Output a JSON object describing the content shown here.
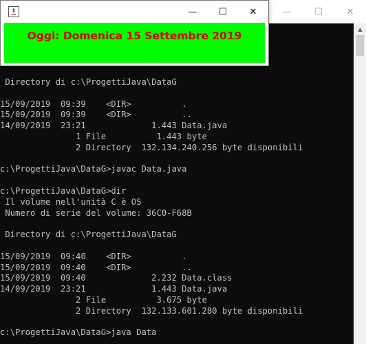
{
  "java_window": {
    "date_text": "Oggi: Domenica 15 Settembre 2019",
    "background_color": "#00ff00",
    "text_color": "#d40000"
  },
  "console": {
    "lines": [
      " Directory di c:\\ProgettiJava\\DataG",
      "",
      "15/09/2019  09:39    <DIR>          .",
      "15/09/2019  09:39    <DIR>          ..",
      "14/09/2019  23:21             1.443 Data.java",
      "               1 File          1.443 byte",
      "               2 Directory  132.134.240.256 byte disponibili",
      "",
      "c:\\ProgettiJava\\DataG>javac Data.java",
      "",
      "c:\\ProgettiJava\\DataG>dir",
      " Il volume nell'unità C è OS",
      " Numero di serie del volume: 36C0-F68B",
      "",
      " Directory di c:\\ProgettiJava\\DataG",
      "",
      "15/09/2019  09:40    <DIR>          .",
      "15/09/2019  09:40    <DIR>          ..",
      "15/09/2019  09:40             2.232 Data.class",
      "14/09/2019  23:21             1.443 Data.java",
      "               2 File          3.675 byte",
      "               2 Directory  132.133.601.280 byte disponibili",
      "",
      "c:\\ProgettiJava\\DataG>java Data"
    ]
  }
}
